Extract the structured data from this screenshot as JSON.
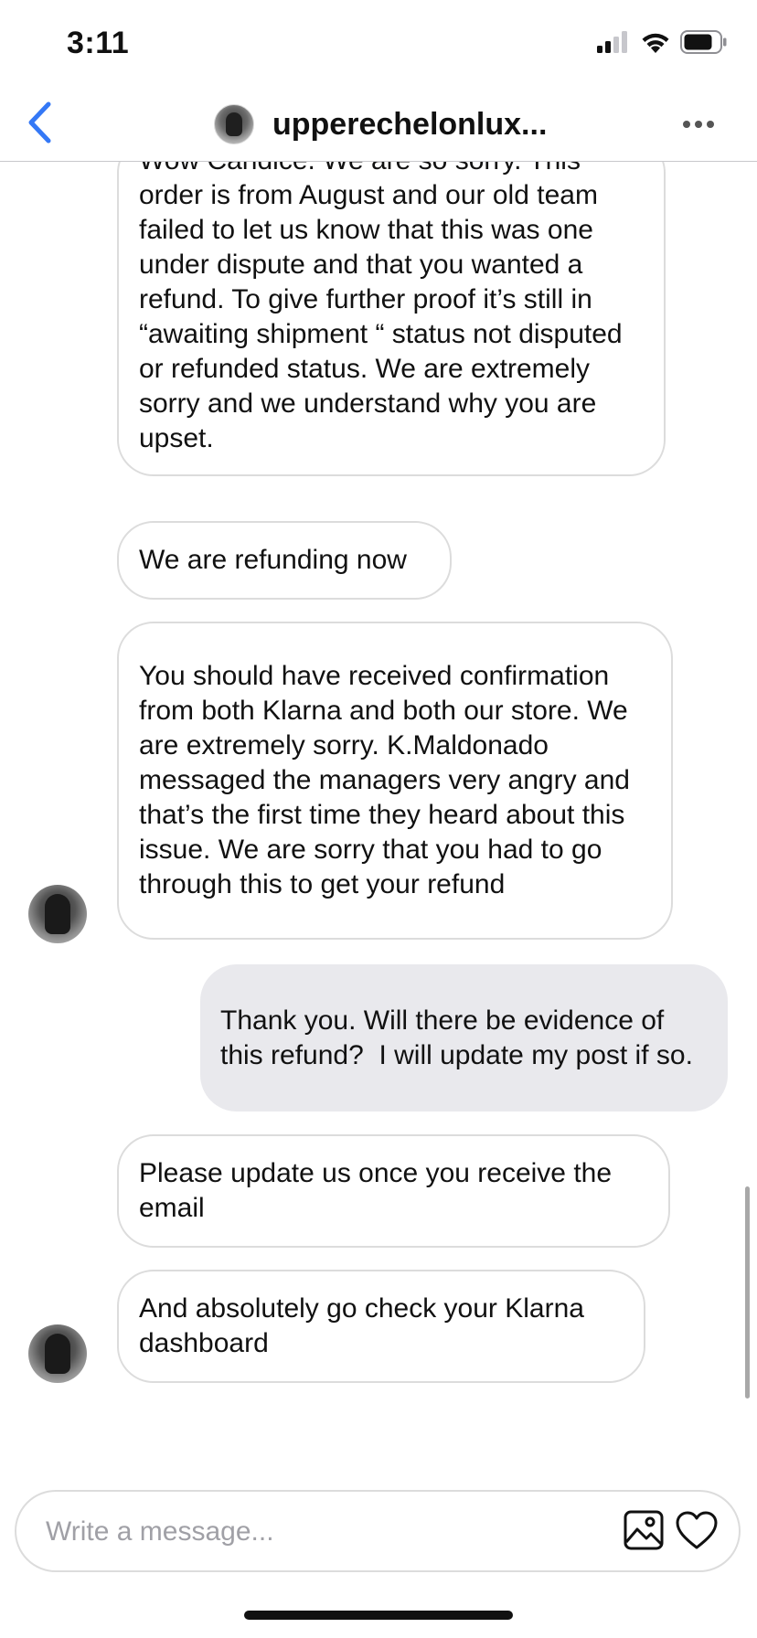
{
  "status_bar": {
    "time": "3:11"
  },
  "header": {
    "title": "upperechelonlux...",
    "back_icon": "chevron-left-icon",
    "more_icon": "ellipsis-icon"
  },
  "messages": [
    {
      "direction": "incoming",
      "text": "Wow Candice. We are so sorry. This order is from August and our old team failed to let us know that this was one under dispute and that you wanted a refund. To give further proof it’s still in “awaiting shipment “ status not disputed or refunded status. We are extremely sorry and we understand why you are upset."
    },
    {
      "direction": "incoming",
      "text": "We are refunding now"
    },
    {
      "direction": "incoming",
      "text": "You should have received confirmation from both Klarna and both our store. We are extremely sorry. K.Maldonado messaged the managers very angry and that’s the first time they heard about this issue. We are sorry that you had to go through this to get your refund"
    },
    {
      "direction": "outgoing",
      "text": "Thank you. Will there be evidence of this refund?  I will update my post if so."
    },
    {
      "direction": "incoming",
      "text": "Please update us once you receive the email"
    },
    {
      "direction": "incoming",
      "text": "And absolutely go check your Klarna dashboard"
    }
  ],
  "composer": {
    "placeholder": "Write a message...",
    "value": "",
    "photo_icon": "image-icon",
    "like_icon": "heart-icon"
  },
  "colors": {
    "accent": "#3478f6",
    "outgoing_bubble": "#e9e9ed",
    "incoming_border": "#dcdcdc",
    "placeholder": "#a0a0a6"
  }
}
